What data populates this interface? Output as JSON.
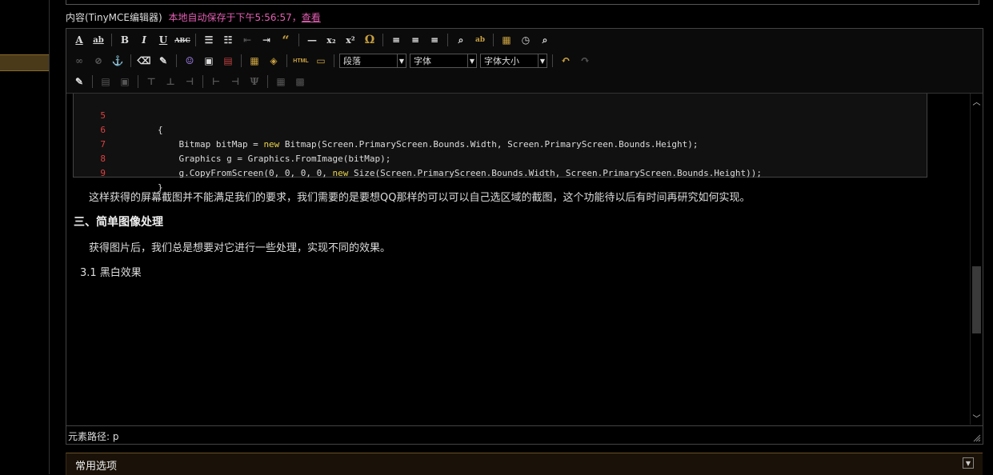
{
  "header": {
    "content_label": "内容(TinyMCE编辑器)",
    "autosave_text": "本地自动保存于下午5:56:57，",
    "view_link": "查看"
  },
  "toolbar": {
    "row1": [
      {
        "name": "font-color-icon",
        "glyph": "A"
      },
      {
        "name": "highlight-color-icon",
        "glyph": "ab"
      },
      {
        "name": "bold-icon",
        "glyph": "B"
      },
      {
        "name": "italic-icon",
        "glyph": "I"
      },
      {
        "name": "underline-icon",
        "glyph": "U"
      },
      {
        "name": "strikethrough-icon",
        "glyph": "ABC"
      },
      {
        "name": "bullet-list-icon",
        "glyph": "☰"
      },
      {
        "name": "numbered-list-icon",
        "glyph": "☷"
      },
      {
        "name": "outdent-icon",
        "glyph": "⇤"
      },
      {
        "name": "indent-icon",
        "glyph": "⇥"
      },
      {
        "name": "blockquote-icon",
        "glyph": "“"
      },
      {
        "name": "horizontal-rule-icon",
        "glyph": "—"
      },
      {
        "name": "subscript-icon",
        "glyph": "x₂"
      },
      {
        "name": "superscript-icon",
        "glyph": "x²"
      },
      {
        "name": "special-char-icon",
        "glyph": "Ω"
      },
      {
        "name": "align-left-icon",
        "glyph": "≡"
      },
      {
        "name": "align-center-icon",
        "glyph": "≡"
      },
      {
        "name": "align-right-icon",
        "glyph": "≡"
      },
      {
        "name": "find-icon",
        "glyph": "🔍"
      },
      {
        "name": "replace-icon",
        "glyph": "ab"
      },
      {
        "name": "insert-date-icon",
        "glyph": "📅"
      },
      {
        "name": "insert-time-icon",
        "glyph": "◷"
      },
      {
        "name": "preview-icon",
        "glyph": "🔎"
      }
    ],
    "row2": [
      {
        "name": "link-icon",
        "glyph": "∞"
      },
      {
        "name": "unlink-icon",
        "glyph": "⊘"
      },
      {
        "name": "anchor-icon",
        "glyph": "⚓"
      },
      {
        "name": "eraser-icon",
        "glyph": "⌫"
      },
      {
        "name": "clean-format-icon",
        "glyph": "✎"
      },
      {
        "name": "insert-emoticon-icon",
        "glyph": "☺"
      },
      {
        "name": "insert-image-icon",
        "glyph": "▣"
      },
      {
        "name": "insert-media-icon",
        "glyph": "▤"
      },
      {
        "name": "insert-file-icon",
        "glyph": "▦"
      },
      {
        "name": "insert-code-icon",
        "glyph": "◈"
      }
    ],
    "html_label": "HTML",
    "paragraph_select": "段落",
    "font_select": "字体",
    "font_size_select": "字体大小"
  },
  "code_block": {
    "lines": [
      {
        "num": "5",
        "text": "        {"
      },
      {
        "num": "6",
        "prefix": "            Bitmap bitMap = ",
        "keyword": "new",
        "suffix": " Bitmap(Screen.PrimaryScreen.Bounds.Width, Screen.PrimaryScreen.Bounds.Height);"
      },
      {
        "num": "7",
        "text": "            Graphics g = Graphics.FromImage(bitMap);"
      },
      {
        "num": "8",
        "prefix": "            g.CopyFromScreen(0, 0, 0, 0, ",
        "keyword": "new",
        "suffix": " Size(Screen.PrimaryScreen.Bounds.Width, Screen.PrimaryScreen.Bounds.Height));"
      },
      {
        "num": "9",
        "text": "        }"
      }
    ]
  },
  "content": {
    "paragraph1": "这样获得的屏幕截图并不能满足我们的要求，我们需要的是要想QQ那样的可以可以自己选区域的截图，这个功能待以后有时间再研究如何实现。",
    "heading3": "三、简单图像处理",
    "paragraph2": "获得图片后，我们总是想要对它进行一些处理，实现不同的效果。",
    "subheading": "3.1 黑白效果"
  },
  "status": {
    "element_path": "元素路径: p"
  },
  "panel": {
    "common_options": "常用选项"
  }
}
